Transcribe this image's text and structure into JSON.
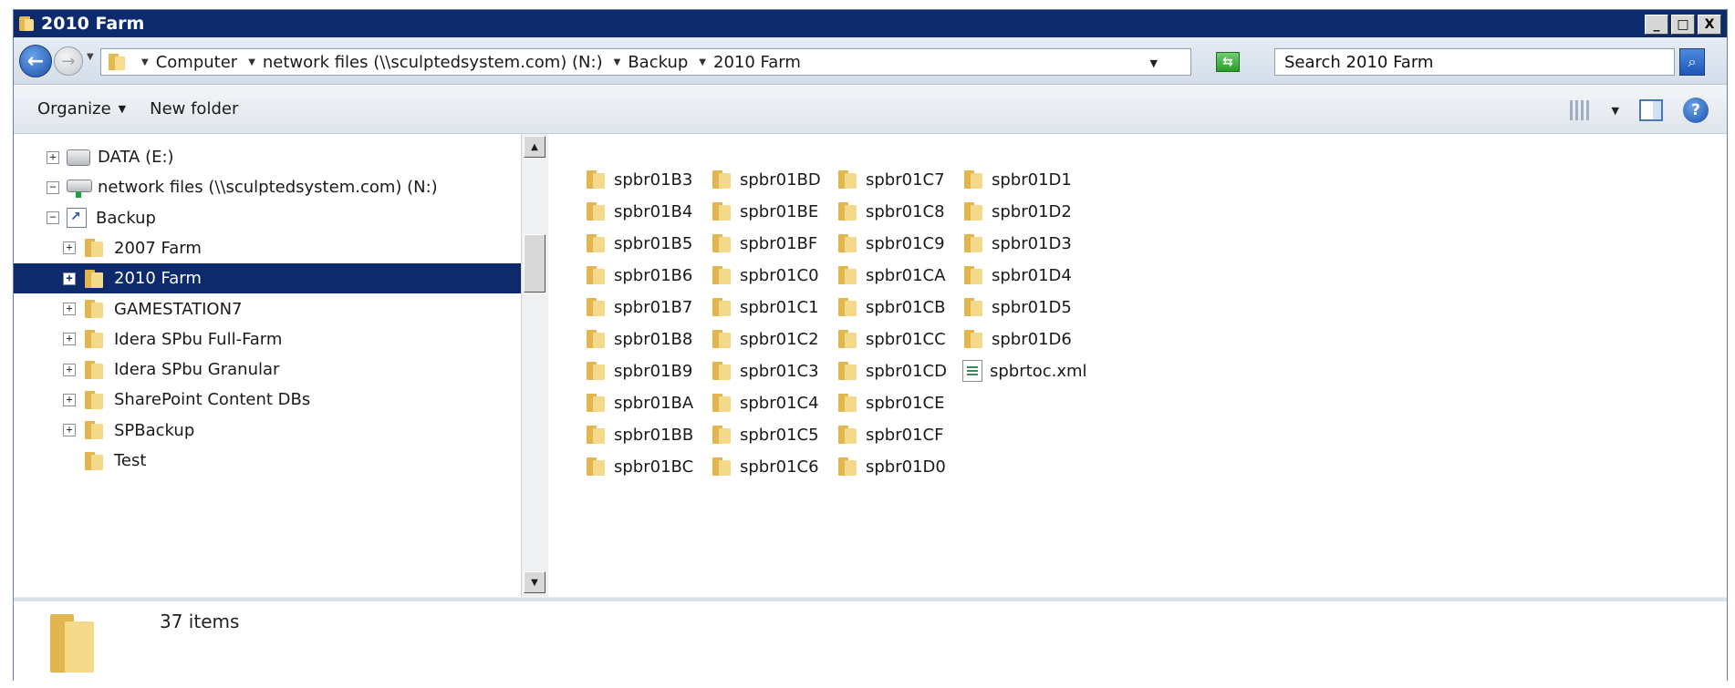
{
  "window": {
    "title": "2010 Farm",
    "controls": {
      "minimize": "_",
      "maximize": "□",
      "close": "X"
    }
  },
  "address": {
    "breadcrumbs": [
      "Computer",
      "network files (\\\\sculptedsystem.com) (N:)",
      "Backup",
      "2010 Farm"
    ],
    "search_placeholder": "Search 2010 Farm"
  },
  "toolbar": {
    "organize_label": "Organize",
    "new_folder_label": "New folder"
  },
  "nav_tree": [
    {
      "label": "DATA (E:)",
      "icon": "drive-icon",
      "expander": "+",
      "level": 0,
      "selected": false
    },
    {
      "label": "network files (\\\\sculptedsystem.com) (N:)",
      "icon": "network-drive-icon",
      "expander": "−",
      "level": 0,
      "selected": false
    },
    {
      "label": "Backup",
      "icon": "shortcut-folder-icon",
      "expander": "−",
      "level": 1,
      "selected": false
    },
    {
      "label": "2007 Farm",
      "icon": "folder-icon",
      "expander": "+",
      "level": 2,
      "selected": false
    },
    {
      "label": "2010 Farm",
      "icon": "folder-icon",
      "expander": "+",
      "level": 2,
      "selected": true
    },
    {
      "label": "GAMESTATION7",
      "icon": "folder-icon",
      "expander": "+",
      "level": 2,
      "selected": false
    },
    {
      "label": "Idera SPbu Full-Farm",
      "icon": "folder-icon",
      "expander": "+",
      "level": 2,
      "selected": false
    },
    {
      "label": "Idera SPbu Granular",
      "icon": "folder-icon",
      "expander": "+",
      "level": 2,
      "selected": false
    },
    {
      "label": "SharePoint Content DBs",
      "icon": "folder-icon",
      "expander": "+",
      "level": 2,
      "selected": false
    },
    {
      "label": "SPBackup",
      "icon": "folder-icon",
      "expander": "+",
      "level": 2,
      "selected": false
    },
    {
      "label": "Test",
      "icon": "folder-icon",
      "expander": "",
      "level": 2,
      "selected": false
    }
  ],
  "files": {
    "columns": [
      [
        "spbr01B3",
        "spbr01B4",
        "spbr01B5",
        "spbr01B6",
        "spbr01B7",
        "spbr01B8",
        "spbr01B9",
        "spbr01BA",
        "spbr01BB",
        "spbr01BC"
      ],
      [
        "spbr01BD",
        "spbr01BE",
        "spbr01BF",
        "spbr01C0",
        "spbr01C1",
        "spbr01C2",
        "spbr01C3",
        "spbr01C4",
        "spbr01C5",
        "spbr01C6"
      ],
      [
        "spbr01C7",
        "spbr01C8",
        "spbr01C9",
        "spbr01CA",
        "spbr01CB",
        "spbr01CC",
        "spbr01CD",
        "spbr01CE",
        "spbr01CF",
        "spbr01D0"
      ],
      [
        "spbr01D1",
        "spbr01D2",
        "spbr01D3",
        "spbr01D4",
        "spbr01D5",
        "spbr01D6",
        "spbrtoc.xml"
      ]
    ]
  },
  "details": {
    "item_count": "37 items"
  }
}
